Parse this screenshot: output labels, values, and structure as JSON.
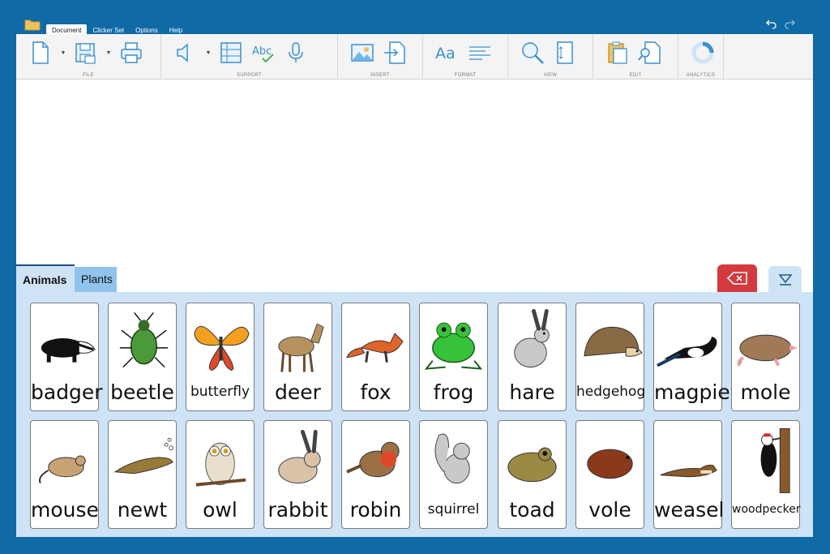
{
  "menu": {
    "tabs": [
      "Document",
      "Clicker Set",
      "Options",
      "Help"
    ],
    "active": "Document"
  },
  "ribbon": {
    "groups": [
      {
        "label": "FILE"
      },
      {
        "label": "SUPPORT"
      },
      {
        "label": "INSERT"
      },
      {
        "label": "FORMAT"
      },
      {
        "label": "VIEW"
      },
      {
        "label": "EDIT"
      },
      {
        "label": "ANALYTICS"
      }
    ]
  },
  "sets": {
    "tabs": [
      "Animals",
      "Plants"
    ],
    "active": "Animals"
  },
  "colors": {
    "background": "#0f6aa6",
    "panel": "#cfe3f7",
    "backspace": "#d33a3e",
    "ribbon": "#f4f4f4"
  },
  "cards": [
    {
      "word": "badger",
      "icon": "badger-icon"
    },
    {
      "word": "beetle",
      "icon": "beetle-icon"
    },
    {
      "word": "butterfly",
      "icon": "butterfly-icon"
    },
    {
      "word": "deer",
      "icon": "deer-icon"
    },
    {
      "word": "fox",
      "icon": "fox-icon"
    },
    {
      "word": "frog",
      "icon": "frog-icon"
    },
    {
      "word": "hare",
      "icon": "hare-icon"
    },
    {
      "word": "hedgehog",
      "icon": "hedgehog-icon"
    },
    {
      "word": "magpie",
      "icon": "magpie-icon"
    },
    {
      "word": "mole",
      "icon": "mole-icon"
    },
    {
      "word": "mouse",
      "icon": "mouse-icon"
    },
    {
      "word": "newt",
      "icon": "newt-icon"
    },
    {
      "word": "owl",
      "icon": "owl-icon"
    },
    {
      "word": "rabbit",
      "icon": "rabbit-icon"
    },
    {
      "word": "robin",
      "icon": "robin-icon"
    },
    {
      "word": "squirrel",
      "icon": "squirrel-icon"
    },
    {
      "word": "toad",
      "icon": "toad-icon"
    },
    {
      "word": "vole",
      "icon": "vole-icon"
    },
    {
      "word": "weasel",
      "icon": "weasel-icon"
    },
    {
      "word": "woodpecker",
      "icon": "woodpecker-icon"
    }
  ]
}
